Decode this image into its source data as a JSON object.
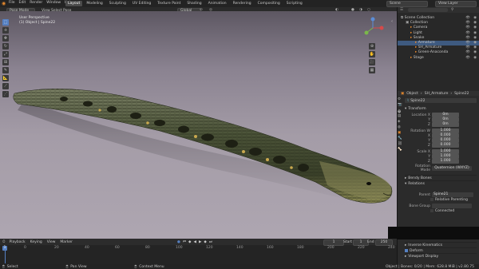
{
  "topbar": {
    "menus": [
      "File",
      "Edit",
      "Render",
      "Window",
      "Help"
    ],
    "tabs": [
      "Layout",
      "Modeling",
      "Sculpting",
      "UV Editing",
      "Texture Paint",
      "Shading",
      "Animation",
      "Rendering",
      "Compositing",
      "Scripting"
    ],
    "active_tab": "Layout",
    "scene": "Scene",
    "view_layer": "View Layer"
  },
  "viewport": {
    "mode": "Pose Mode",
    "header_menus": [
      "View",
      "Select",
      "Pose"
    ],
    "transform": "Global",
    "overlay_line1": "User Perspective",
    "overlay_line2": "(1) Object | Spine22"
  },
  "outliner": {
    "items": [
      {
        "label": "Scene Collection",
        "indent": 0
      },
      {
        "label": "Collection",
        "indent": 1
      },
      {
        "label": "Camera",
        "indent": 2
      },
      {
        "label": "Light",
        "indent": 2
      },
      {
        "label": "Snake",
        "indent": 2
      },
      {
        "label": "Armature",
        "indent": 3,
        "highlight": true
      },
      {
        "label": "SH_Armature",
        "indent": 3
      },
      {
        "label": "Green-Anaconda",
        "indent": 3
      },
      {
        "label": "Stage",
        "indent": 2
      }
    ]
  },
  "properties": {
    "breadcrumb": [
      "Object",
      "SH_Armature",
      "Spine22"
    ],
    "bone_name": "Spine22",
    "transform_header": "Transform",
    "location_label": "Location X",
    "location": [
      "0m",
      "0m",
      "0m"
    ],
    "rotation_label": "Rotation W",
    "rotation": [
      "1.000",
      "0.000",
      "0.000",
      "0.000"
    ],
    "scale_label": "Scale X",
    "scale": [
      "1.000",
      "1.000",
      "1.000"
    ],
    "axis_labels": [
      "Y",
      "Z",
      "X"
    ],
    "rotation_mode_label": "Rotation Mode",
    "rotation_mode": "Quaternion (WXYZ)",
    "bendy_bones": "Bendy Bones",
    "relations": "Relations",
    "parent_label": "Parent",
    "parent": "Spine21",
    "relative_parenting": "Relative Parenting",
    "bone_group_label": "Bone Group",
    "connected": "Connected",
    "inverse_kinematics": "Inverse Kinematics",
    "deform": "Deform",
    "viewport_display": "Viewport Display"
  },
  "timeline": {
    "menus": [
      "Playback",
      "Keying",
      "View",
      "Marker"
    ],
    "current_frame": "1",
    "start_label": "Start",
    "start": "1",
    "end_label": "End",
    "end": "250",
    "ticks": [
      "0",
      "20",
      "40",
      "60",
      "80",
      "100",
      "120",
      "140",
      "160",
      "180",
      "200",
      "220",
      "240"
    ]
  },
  "statusbar": {
    "left": "Select",
    "mid1": "Pan View",
    "mid2": "Context Menu",
    "right": "Object | Bones: 0/20 | Mem: 628.8 MiB | v2.80.75"
  }
}
